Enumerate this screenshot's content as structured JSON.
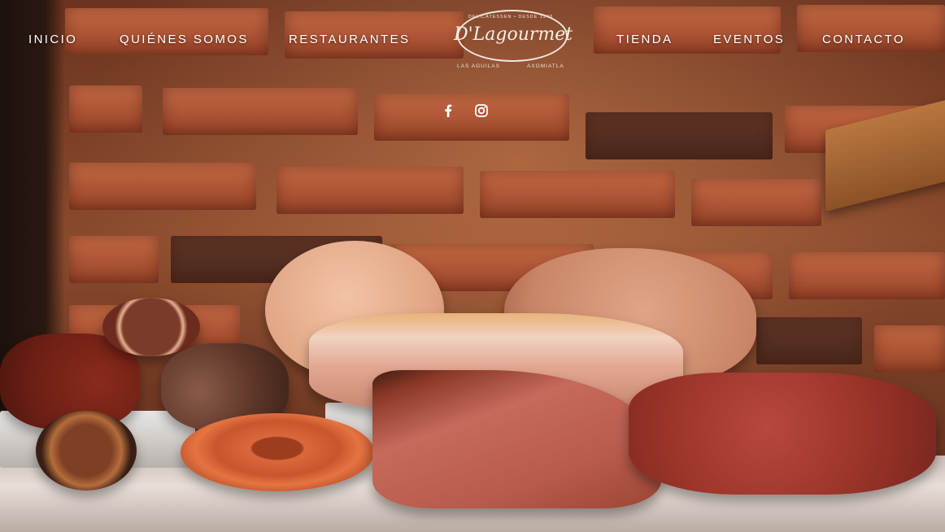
{
  "nav": {
    "links_left": [
      "INICIO",
      "QUIÉNES SOMOS",
      "RESTAURANTES"
    ],
    "links_right": [
      "TIENDA",
      "EVENTOS",
      "CONTACTO"
    ]
  },
  "logo": {
    "tagline": "DELICATESSEN • DESDE 1978",
    "name": "D'Lagourmet",
    "location_left": "LAS AGUILAS",
    "location_right": "AXOMIATLA"
  },
  "social": {
    "icons": [
      "facebook-icon",
      "instagram-icon"
    ]
  },
  "colors": {
    "nav_text": "#ffffff",
    "brick": "#b85a38"
  }
}
